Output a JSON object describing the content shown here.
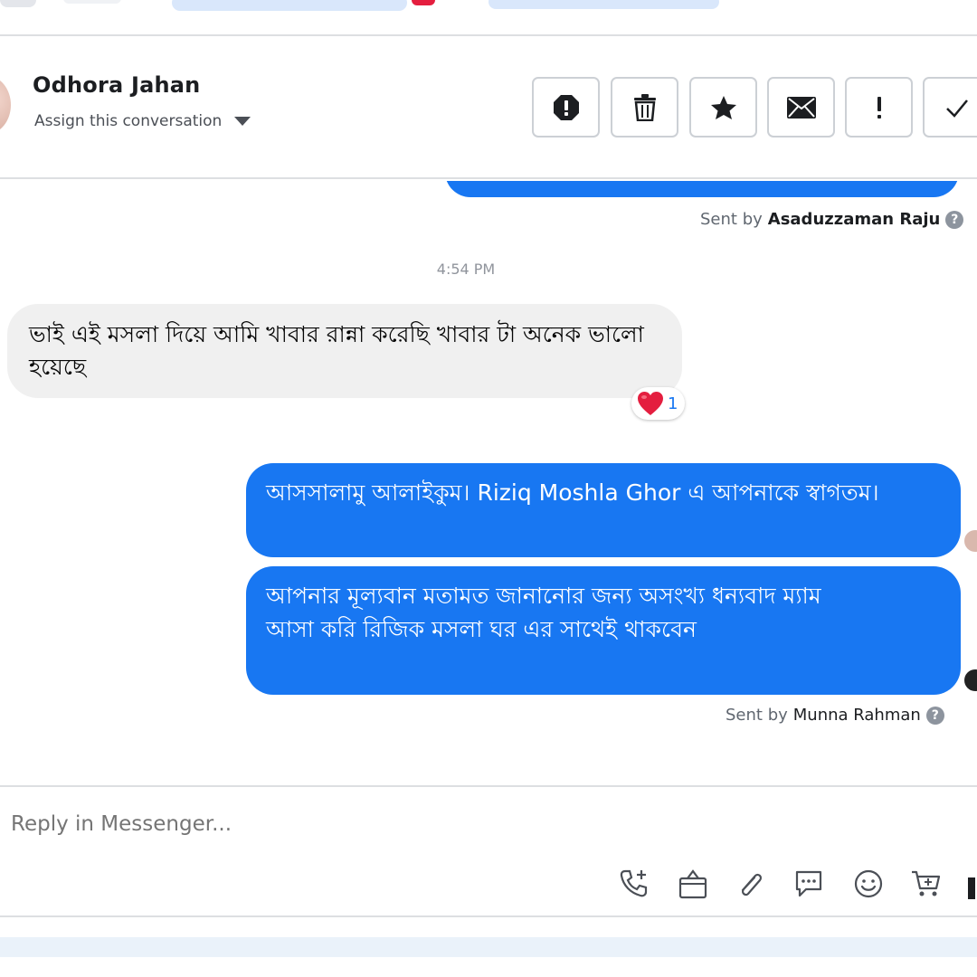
{
  "header": {
    "name": "Odhora Jahan",
    "assign_label": "Assign this conversation"
  },
  "toolbar": {
    "buttons": [
      {
        "icon": "spam-icon",
        "label": "Mark as spam"
      },
      {
        "icon": "trash-icon",
        "label": "Delete"
      },
      {
        "icon": "star-icon",
        "label": "Follow up"
      },
      {
        "icon": "envelope-icon",
        "label": "Mark as unread"
      },
      {
        "icon": "exclamation-icon",
        "label": "Priority"
      },
      {
        "icon": "checkmark-icon",
        "label": "Mark as done"
      }
    ]
  },
  "thread": {
    "sent_by_label": "Sent by",
    "first_sender": "Asaduzzaman Raju",
    "timestamp": "4:54 PM",
    "incoming_message": "ভাই এই মসলা দিয়ে আমি খাবার রান্না করেছি খাবার টা অনেক ভালো হয়েছে",
    "reaction": {
      "emoji": "❤️",
      "count": "1"
    },
    "outgoing_1": "আসসালামু আলাইকুম। Riziq Moshla Ghor এ আপনাকে স্বাগতম।",
    "outgoing_2_line1": "আপনার মূল্যবান মতামত জানানোর জন্য অসংখ্য ধন্যবাদ ম্যাম",
    "outgoing_2_line2": "আসা করি রিজিক মসলা ঘর এর সাথেই থাকবেন",
    "second_sender": "Munna Rahman"
  },
  "composer": {
    "placeholder": "Reply in Messenger...",
    "icons": [
      "call-add-icon",
      "shopping-bag-icon",
      "paperclip-icon",
      "chat-bubble-icon",
      "emoji-icon",
      "cart-add-icon"
    ]
  },
  "colors": {
    "outgoing_bubble": "#1877f2",
    "incoming_bubble": "#f0f0f0",
    "border": "#ccd0d5"
  }
}
